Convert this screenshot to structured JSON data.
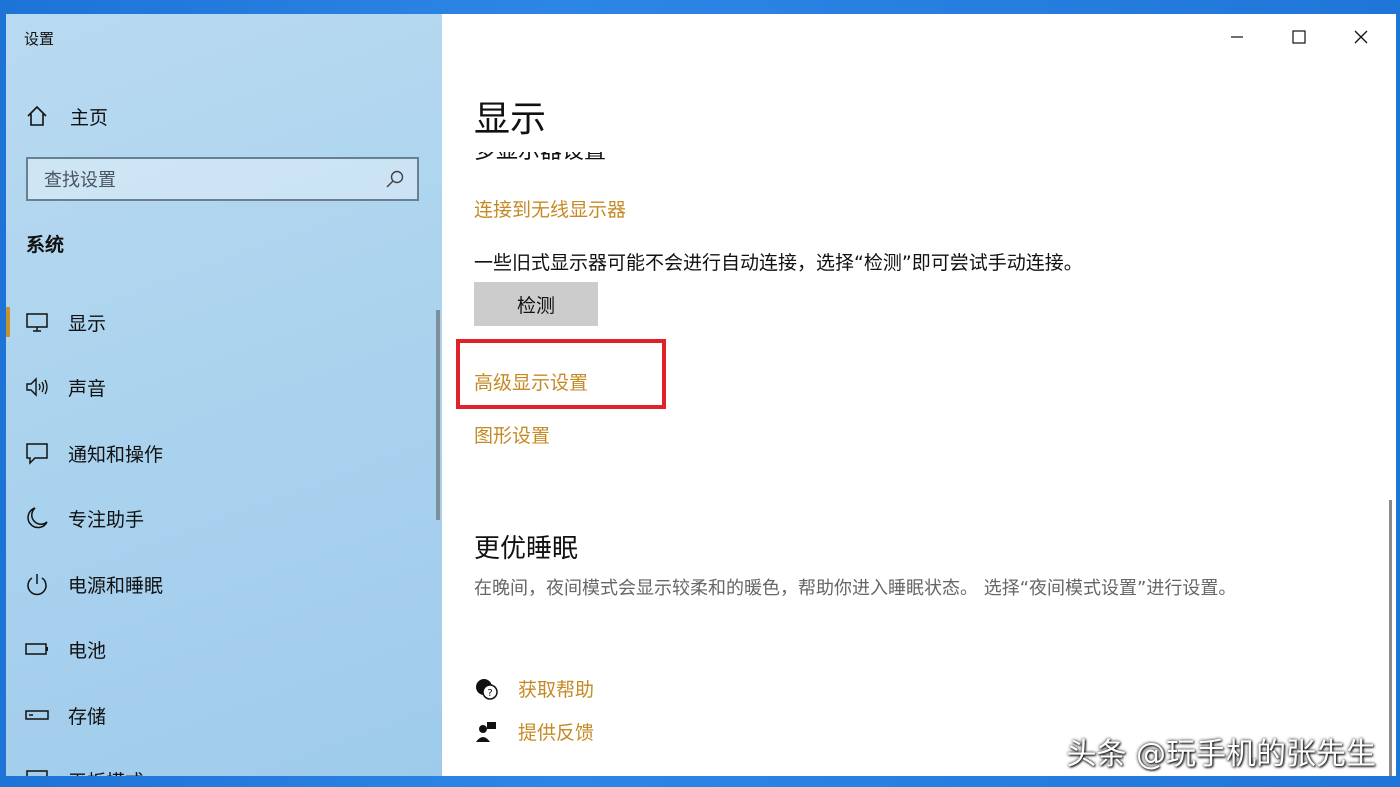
{
  "window": {
    "title": "设置"
  },
  "sidebar": {
    "home_label": "主页",
    "search_placeholder": "查找设置",
    "section_title": "系统",
    "items": [
      {
        "label": "显示",
        "icon": "monitor-icon",
        "active": true
      },
      {
        "label": "声音",
        "icon": "speaker-icon"
      },
      {
        "label": "通知和操作",
        "icon": "notification-icon"
      },
      {
        "label": "专注助手",
        "icon": "moon-icon"
      },
      {
        "label": "电源和睡眠",
        "icon": "power-icon"
      },
      {
        "label": "电池",
        "icon": "battery-icon"
      },
      {
        "label": "存储",
        "icon": "storage-icon"
      },
      {
        "label": "平板模式",
        "icon": "tablet-icon"
      }
    ]
  },
  "main": {
    "page_title": "显示",
    "clipped_heading": "多显示器设置",
    "wireless_link": "连接到无线显示器",
    "description": "一些旧式显示器可能不会进行自动连接，选择“检测”即可尝试手动连接。",
    "detect_button": "检测",
    "advanced_link": "高级显示设置",
    "graphics_link": "图形设置",
    "sleep_heading": "更优睡眠",
    "sleep_description": "在晚间，夜间模式会显示较柔和的暖色，帮助你进入睡眠状态。 选择“夜间模式设置”进行设置。",
    "help_link": "获取帮助",
    "feedback_link": "提供反馈"
  },
  "watermark": "头条 @玩手机的张先生",
  "colors": {
    "accent": "#c68a25",
    "highlight_box": "#e0232a",
    "sidebar_bg": "#a9d2ee"
  }
}
